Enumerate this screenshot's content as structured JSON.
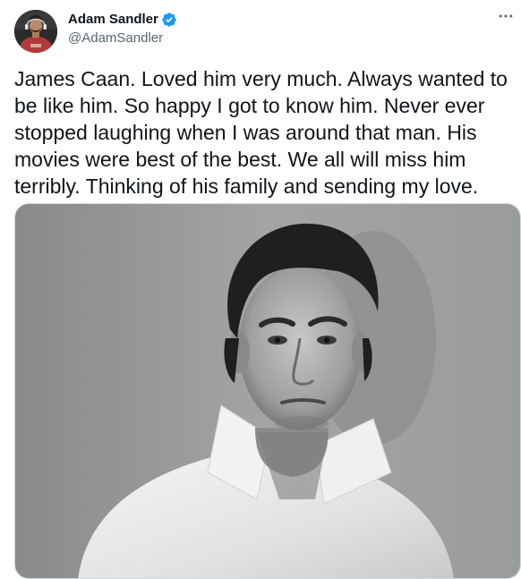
{
  "tweet": {
    "author": {
      "display_name": "Adam Sandler",
      "handle": "@AdamSandler",
      "verified": true
    },
    "text": "James Caan. Loved him very much. Always wanted to be like him. So happy I got to know him. Never ever stopped laughing when I was around that man. His movies were best of the best. We all will miss him terribly. Thinking of his family and sending my love.",
    "media": {
      "kind": "photo",
      "style": "black-and-white portrait"
    },
    "icons": {
      "verified": "verified-badge-icon",
      "more": "more-options-icon"
    }
  },
  "colors": {
    "text": "#0f1419",
    "secondary": "#536471",
    "verified": "#1d9bf0",
    "border": "#cfd9de"
  }
}
